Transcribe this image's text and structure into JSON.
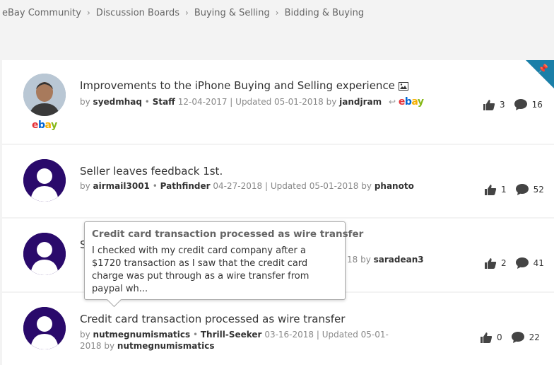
{
  "breadcrumb": [
    "eBay Community",
    "Discussion Boards",
    "Buying & Selling",
    "Bidding & Buying"
  ],
  "threads": [
    {
      "title": "Improvements to the iPhone Buying and Selling experience",
      "by": "by",
      "author": "syedmhaq",
      "rank": "Staff",
      "date": "12-04-2017",
      "updated": "Updated 05-01-2018 by",
      "last_user": "jandjram",
      "likes": "3",
      "replies": "16"
    },
    {
      "title": "Seller leaves feedback 1st.",
      "by": "by",
      "author": "airmail3001",
      "rank": "Pathfinder",
      "date": "04-27-2018",
      "updated": "Updated 05-01-2018 by",
      "last_user": "phanoto",
      "likes": "1",
      "replies": "52"
    },
    {
      "title_partial": "S",
      "meta_partial": "18 by",
      "last_user": "saradean3",
      "likes": "2",
      "replies": "41"
    },
    {
      "title": "Credit card transaction processed as wire transfer",
      "by": "by",
      "author": "nutmegnumismatics",
      "rank": "Thrill-Seeker",
      "date": "03-16-2018",
      "updated": "Updated 05-01-2018 by",
      "last_user": "nutmegnumismatics",
      "likes": "0",
      "replies": "22"
    }
  ],
  "tooltip": {
    "title": "Credit card transaction processed as wire transfer",
    "body": "I checked with my credit card company after a $1720 transaction as I saw that the credit card charge was put through as a wire transfer from paypal wh..."
  },
  "colors": {
    "pin": "#1a7fa8",
    "avatar": "#2a0a6b"
  }
}
